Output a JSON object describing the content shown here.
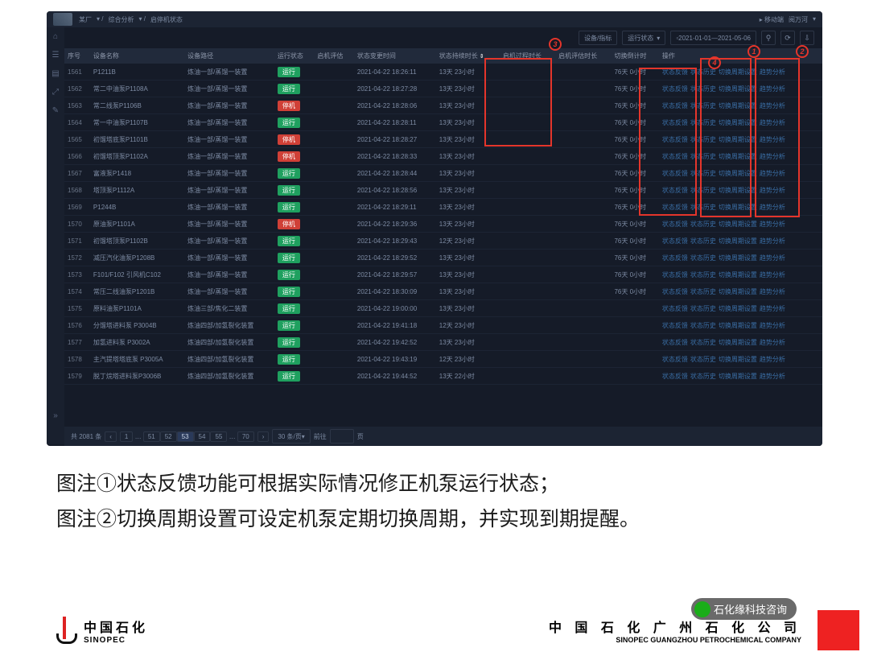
{
  "breadcrumb": {
    "root": "某厂",
    "mid": "综合分析",
    "leaf": "启停机状态"
  },
  "topright": {
    "mode": "移动端",
    "user": "阅万河"
  },
  "filter": {
    "device": "设备/指标",
    "status": "运行状态",
    "date_from": "2021-01-01",
    "date_to": "2021-05-06"
  },
  "sidebar_icons": [
    "⌂",
    "☰",
    "🗐",
    "⤢",
    "✎"
  ],
  "columns": [
    "序号",
    "设备名称",
    "设备路径",
    "运行状态",
    "启机评估",
    "状态变更时间",
    "状态持续时长",
    "启机过程时长",
    "启机评估时长",
    "切换倒计时",
    "操作"
  ],
  "status_label": {
    "run": "运行",
    "stop": "停机"
  },
  "actions": [
    "状态反馈",
    "状态历史",
    "切换周期设置",
    "趋势分析"
  ],
  "rows": [
    {
      "idx": "1561",
      "name": "P1211B",
      "path": "炼油一部/蒸馏一装置",
      "st": "run",
      "time": "2021-04-22 18:26:11",
      "dur": "13天 23小时",
      "cd": "76天 0小时"
    },
    {
      "idx": "1562",
      "name": "常二中油泵P1108A",
      "path": "炼油一部/蒸馏一装置",
      "st": "run",
      "time": "2021-04-22 18:27:28",
      "dur": "13天 23小时",
      "cd": "76天 0小时"
    },
    {
      "idx": "1563",
      "name": "常二线泵P1106B",
      "path": "炼油一部/蒸馏一装置",
      "st": "stop",
      "time": "2021-04-22 18:28:06",
      "dur": "13天 23小时",
      "cd": "76天 0小时"
    },
    {
      "idx": "1564",
      "name": "常一中油泵P1107B",
      "path": "炼油一部/蒸馏一装置",
      "st": "run",
      "time": "2021-04-22 18:28:11",
      "dur": "13天 23小时",
      "cd": "76天 0小时"
    },
    {
      "idx": "1565",
      "name": "初馏塔底泵P1101B",
      "path": "炼油一部/蒸馏一装置",
      "st": "stop",
      "time": "2021-04-22 18:28:27",
      "dur": "13天 23小时",
      "cd": "76天 0小时"
    },
    {
      "idx": "1566",
      "name": "初馏塔顶泵P1102A",
      "path": "炼油一部/蒸馏一装置",
      "st": "stop",
      "time": "2021-04-22 18:28:33",
      "dur": "13天 23小时",
      "cd": "76天 0小时"
    },
    {
      "idx": "1567",
      "name": "富液泵P1418",
      "path": "炼油一部/蒸馏一装置",
      "st": "run",
      "time": "2021-04-22 18:28:44",
      "dur": "13天 23小时",
      "cd": "76天 0小时"
    },
    {
      "idx": "1568",
      "name": "塔顶泵P1112A",
      "path": "炼油一部/蒸馏一装置",
      "st": "run",
      "time": "2021-04-22 18:28:56",
      "dur": "13天 23小时",
      "cd": "76天 0小时"
    },
    {
      "idx": "1569",
      "name": "P1244B",
      "path": "炼油一部/蒸馏一装置",
      "st": "run",
      "time": "2021-04-22 18:29:11",
      "dur": "13天 23小时",
      "cd": "76天 0小时"
    },
    {
      "idx": "1570",
      "name": "原油泵P1101A",
      "path": "炼油一部/蒸馏一装置",
      "st": "stop",
      "time": "2021-04-22 18:29:36",
      "dur": "13天 23小时",
      "cd": "76天 0小时"
    },
    {
      "idx": "1571",
      "name": "初馏塔顶泵P1102B",
      "path": "炼油一部/蒸馏一装置",
      "st": "run",
      "time": "2021-04-22 18:29:43",
      "dur": "12天 23小时",
      "cd": "76天 0小时"
    },
    {
      "idx": "1572",
      "name": "减压汽化油泵P1208B",
      "path": "炼油一部/蒸馏一装置",
      "st": "run",
      "time": "2021-04-22 18:29:52",
      "dur": "13天 23小时",
      "cd": "76天 0小时"
    },
    {
      "idx": "1573",
      "name": "F101/F102 引风机C102",
      "path": "炼油一部/蒸馏一装置",
      "st": "run",
      "time": "2021-04-22 18:29:57",
      "dur": "13天 23小时",
      "cd": "76天 0小时"
    },
    {
      "idx": "1574",
      "name": "常压二线油泵P1201B",
      "path": "炼油一部/蒸馏一装置",
      "st": "run",
      "time": "2021-04-22 18:30:09",
      "dur": "13天 23小时",
      "cd": "76天 0小时"
    },
    {
      "idx": "1575",
      "name": "原料油泵P1101A",
      "path": "炼油三部/焦化二装置",
      "st": "run",
      "time": "2021-04-22 19:00:00",
      "dur": "13天 23小时",
      "cd": ""
    },
    {
      "idx": "1576",
      "name": "分馏塔进料泵 P3004B",
      "path": "炼油四部/加氢裂化装置",
      "st": "run",
      "time": "2021-04-22 19:41:18",
      "dur": "12天 23小时",
      "cd": ""
    },
    {
      "idx": "1577",
      "name": "加氢进料泵 P3002A",
      "path": "炼油四部/加氢裂化装置",
      "st": "run",
      "time": "2021-04-22 19:42:52",
      "dur": "13天 23小时",
      "cd": ""
    },
    {
      "idx": "1578",
      "name": "主汽提塔塔底泵 P3005A",
      "path": "炼油四部/加氢裂化装置",
      "st": "run",
      "time": "2021-04-22 19:43:19",
      "dur": "12天 23小时",
      "cd": ""
    },
    {
      "idx": "1579",
      "name": "脱丁烷塔进料泵P3006B",
      "path": "炼油四部/加氢裂化装置",
      "st": "run",
      "time": "2021-04-22 19:44:52",
      "dur": "13天 22小时",
      "cd": ""
    }
  ],
  "pager": {
    "total": "共 2081 条",
    "pages": [
      "1",
      "51",
      "52",
      "53",
      "54",
      "55",
      "70"
    ],
    "active": "53",
    "perpage": "30 条/页",
    "goto_label": "前往",
    "goto_suffix": "页"
  },
  "annotations": {
    "a1": "1",
    "a2": "2",
    "a3": "3",
    "a4": "4"
  },
  "caption": "图注①状态反馈功能可根据实际情况修正机泵运行状态；\n图注②切换周期设置可设定机泵定期切换周期，并实现到期提醒。",
  "footer": {
    "sinopec_cn": "中国石化",
    "sinopec_en": "SINOPEC",
    "gz_cn": "中 国 石 化 广 州 石 化 公 司",
    "gz_en": "SINOPEC GUANGZHOU  PETROCHEMICAL COMPANY",
    "bubble": "石化缘科技咨询",
    "brand": ""
  }
}
